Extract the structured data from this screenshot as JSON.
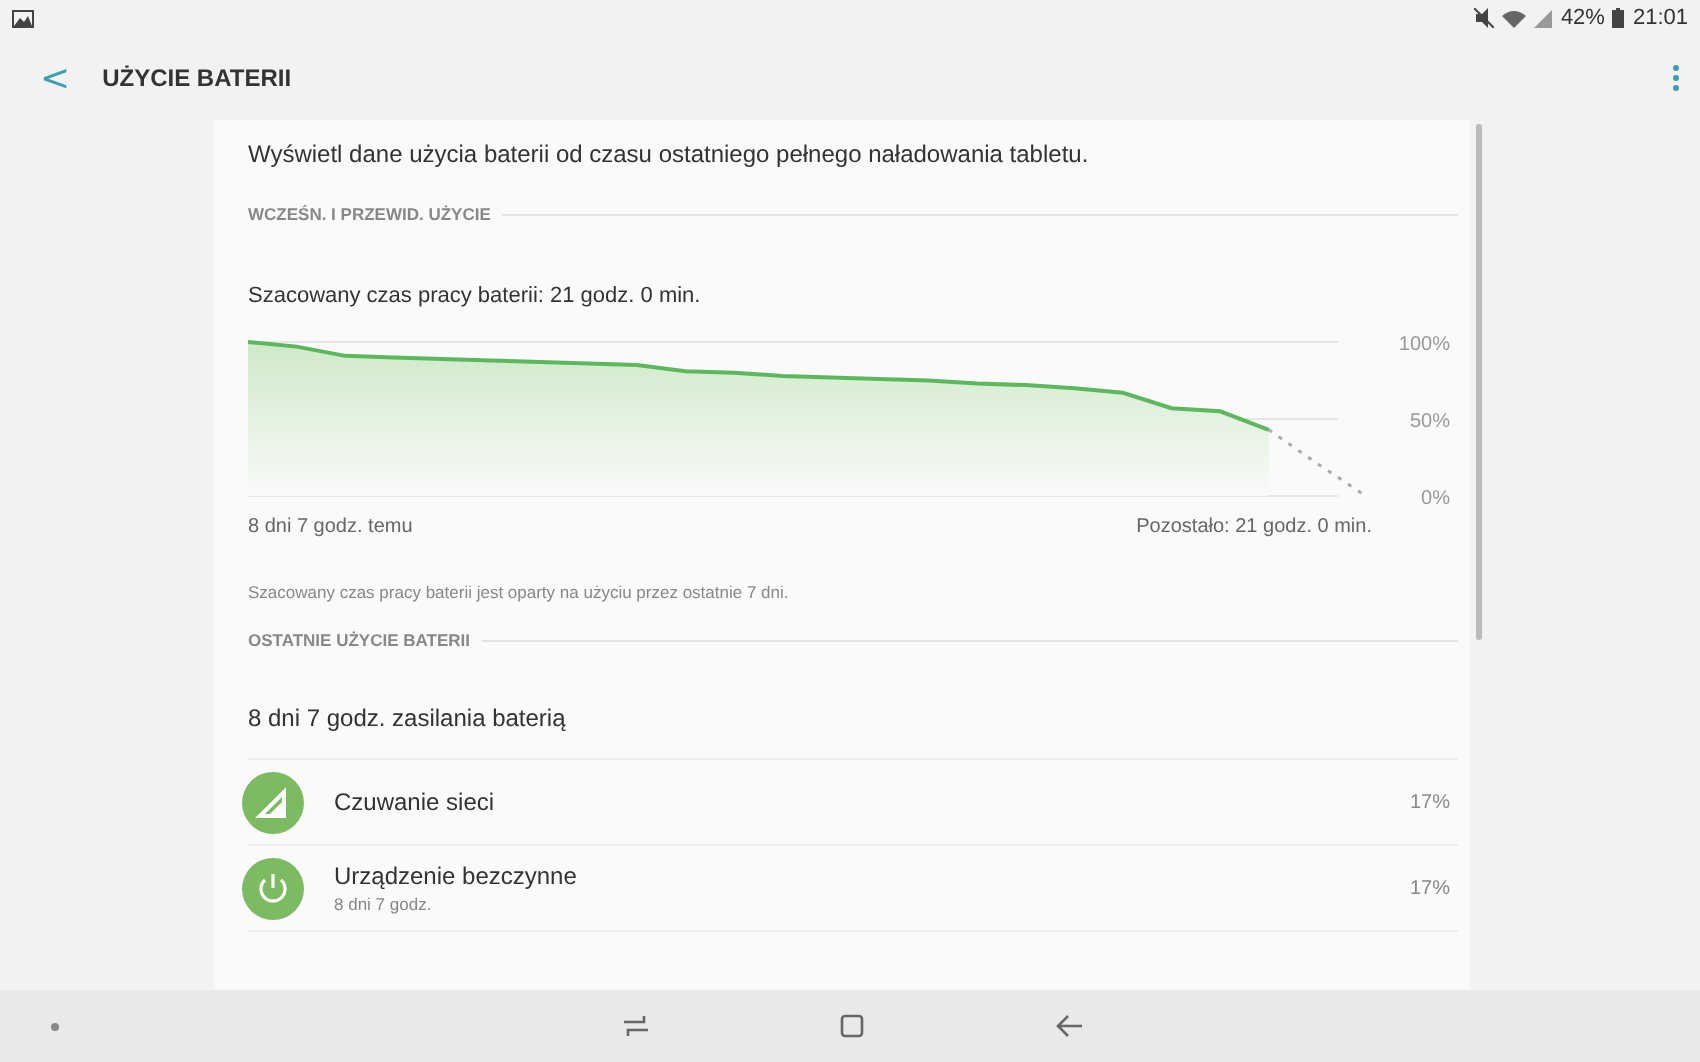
{
  "status_bar": {
    "battery": "42%",
    "time": "21:01"
  },
  "header": {
    "back": "<",
    "title": "UŻYCIE BATERII"
  },
  "intro": "Wyświetl dane użycia baterii od czasu ostatniego pełnego naładowania tabletu.",
  "section_1": {
    "title": "WCZEŚN. I PRZEWID. UŻYCIE",
    "estimate": "Szacowany czas pracy baterii: 21 godz. 0 min.",
    "chart_data": {
      "type": "area",
      "categories": [
        null,
        null,
        null,
        null,
        null,
        null,
        null,
        null,
        null,
        null,
        null,
        null,
        null,
        null,
        null,
        null,
        null,
        null,
        null,
        null,
        null,
        null,
        null,
        null
      ],
      "ylim": [
        0,
        100
      ],
      "yticks": [
        {
          "value": 100,
          "label": "100%"
        },
        {
          "value": 50,
          "label": "50%"
        },
        {
          "value": 0,
          "label": "0%"
        }
      ],
      "series": [
        {
          "color": "#5cb85c",
          "line_style": "solid",
          "values": [
            100,
            97,
            91,
            90,
            89,
            88,
            87,
            86,
            85,
            81,
            80,
            78,
            77,
            76,
            75,
            73,
            72,
            70,
            67,
            57,
            55,
            43,
            null,
            null
          ]
        },
        {
          "type": "line",
          "color": "#aaaaaa",
          "line_style": "dotted",
          "values": [
            null,
            null,
            null,
            null,
            null,
            null,
            null,
            null,
            null,
            null,
            null,
            null,
            null,
            null,
            null,
            null,
            null,
            null,
            null,
            null,
            null,
            43,
            21,
            0
          ]
        }
      ]
    },
    "start_label": "8 dni 7 godz. temu",
    "end_label": "Pozostało: 21 godz. 0 min.",
    "note": "Szacowany czas pracy baterii jest oparty na użyciu przez ostatnie 7 dni."
  },
  "section_2": {
    "title": "OSTATNIE UŻYCIE BATERII",
    "summary": "8 dni 7 godz. zasilania baterią",
    "items": [
      {
        "kind": "signal",
        "name": "Czuwanie sieci",
        "percent": "17%"
      },
      {
        "kind": "power",
        "name": "Urządzenie bezczynne",
        "detail": "8 dni 7 godz.",
        "percent": "17%"
      }
    ]
  }
}
